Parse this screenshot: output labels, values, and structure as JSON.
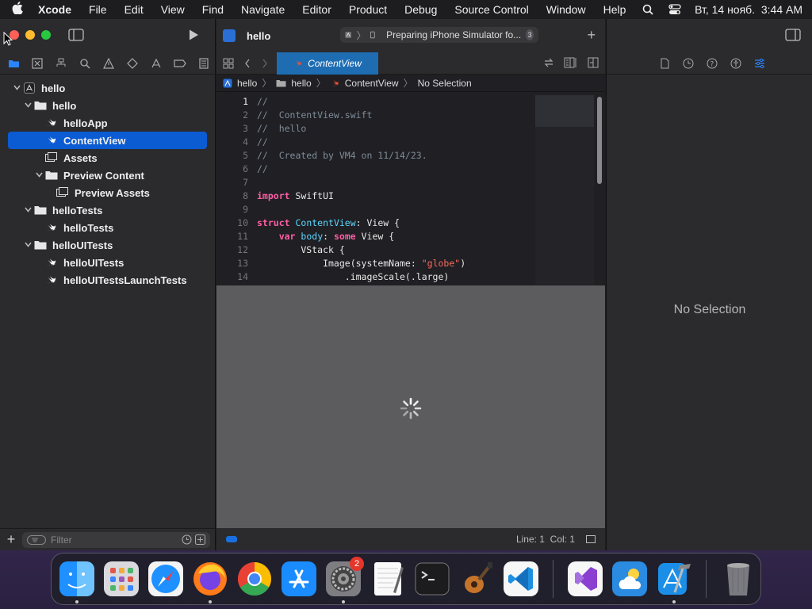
{
  "menubar": {
    "app_name": "Xcode",
    "items": [
      "File",
      "Edit",
      "View",
      "Find",
      "Navigate",
      "Editor",
      "Product",
      "Debug",
      "Source Control",
      "Window",
      "Help"
    ],
    "datetime": "Вт, 14 нояб.  3:44 AM"
  },
  "navigator": {
    "tree": [
      {
        "label": "hello",
        "depth": 0,
        "icon": "xcodeproj-icon",
        "expanded": true
      },
      {
        "label": "hello",
        "depth": 1,
        "icon": "folder-icon",
        "expanded": true
      },
      {
        "label": "helloApp",
        "depth": 2,
        "icon": "swift-file-icon"
      },
      {
        "label": "ContentView",
        "depth": 2,
        "icon": "swift-file-icon",
        "selected": true
      },
      {
        "label": "Assets",
        "depth": 2,
        "icon": "asset-catalog-icon"
      },
      {
        "label": "Preview Content",
        "depth": 2,
        "icon": "folder-icon",
        "expanded": true
      },
      {
        "label": "Preview Assets",
        "depth": 3,
        "icon": "asset-catalog-icon"
      },
      {
        "label": "helloTests",
        "depth": 1,
        "icon": "folder-icon",
        "expanded": true
      },
      {
        "label": "helloTests",
        "depth": 2,
        "icon": "swift-file-icon"
      },
      {
        "label": "helloUITests",
        "depth": 1,
        "icon": "folder-icon",
        "expanded": true
      },
      {
        "label": "helloUITests",
        "depth": 2,
        "icon": "swift-file-icon"
      },
      {
        "label": "helloUITestsLaunchTests",
        "depth": 2,
        "icon": "swift-file-icon"
      }
    ],
    "filter_placeholder": "Filter"
  },
  "editor": {
    "project_title": "hello",
    "activity_status": "Preparing iPhone Simulator fo...",
    "activity_count": "3",
    "active_tab": "ContentView",
    "jumpbar": [
      "hello",
      "hello",
      "ContentView",
      "No Selection"
    ],
    "code_lines": [
      [
        [
          "cm",
          "//"
        ]
      ],
      [
        [
          "cm",
          "//  ContentView.swift"
        ]
      ],
      [
        [
          "cm",
          "//  hello"
        ]
      ],
      [
        [
          "cm",
          "//"
        ]
      ],
      [
        [
          "cm",
          "//  Created by VM4 on 11/14/23."
        ]
      ],
      [
        [
          "cm",
          "//"
        ]
      ],
      [],
      [
        [
          "kw",
          "import"
        ],
        [
          "pl",
          " SwiftUI"
        ]
      ],
      [],
      [
        [
          "kw",
          "struct"
        ],
        [
          "pl",
          " "
        ],
        [
          "ty",
          "ContentView"
        ],
        [
          "pl",
          ": View {"
        ]
      ],
      [
        [
          "pl",
          "    "
        ],
        [
          "kw",
          "var"
        ],
        [
          "pl",
          " "
        ],
        [
          "ty",
          "body"
        ],
        [
          "pl",
          ": "
        ],
        [
          "kw",
          "some"
        ],
        [
          "pl",
          " View {"
        ]
      ],
      [
        [
          "pl",
          "        VStack {"
        ]
      ],
      [
        [
          "pl",
          "            Image(systemName: "
        ],
        [
          "st",
          "\"globe\""
        ],
        [
          "pl",
          ")"
        ]
      ],
      [
        [
          "pl",
          "                .imageScale(.large)"
        ]
      ]
    ],
    "cursor_position": "Line: 1  Col: 1"
  },
  "inspector": {
    "empty_label": "No Selection"
  },
  "dock": {
    "apps": [
      {
        "name": "finder",
        "running": true
      },
      {
        "name": "launchpad",
        "running": false
      },
      {
        "name": "safari",
        "running": false
      },
      {
        "name": "firefox",
        "running": true
      },
      {
        "name": "chrome",
        "running": false
      },
      {
        "name": "app-store",
        "running": false
      },
      {
        "name": "system-settings",
        "running": true,
        "badge": "2"
      },
      {
        "name": "textedit",
        "running": false
      },
      {
        "name": "terminal",
        "running": false
      },
      {
        "name": "garageband",
        "running": false
      },
      {
        "name": "vscode",
        "running": false
      }
    ],
    "recent": [
      {
        "name": "visual-studio",
        "running": false
      },
      {
        "name": "weather",
        "running": false
      },
      {
        "name": "xcode",
        "running": true
      }
    ]
  }
}
